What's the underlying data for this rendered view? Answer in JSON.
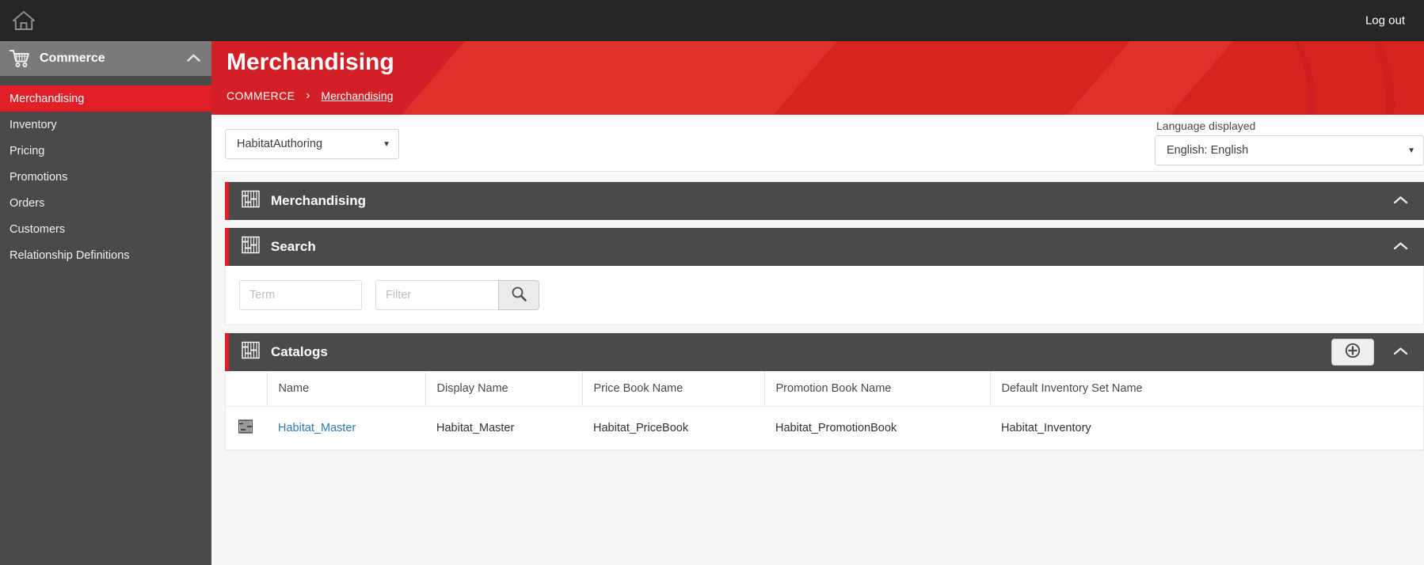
{
  "topbar": {
    "home_icon": "home-icon",
    "logout_label": "Log out"
  },
  "sidebar": {
    "group": {
      "icon": "shopping-cart-icon",
      "label": "Commerce",
      "collapse_icon": "chevron-up-icon"
    },
    "items": [
      {
        "label": "Merchandising",
        "active": true
      },
      {
        "label": "Inventory",
        "active": false
      },
      {
        "label": "Pricing",
        "active": false
      },
      {
        "label": "Promotions",
        "active": false
      },
      {
        "label": "Orders",
        "active": false
      },
      {
        "label": "Customers",
        "active": false
      },
      {
        "label": "Relationship Definitions",
        "active": false
      }
    ]
  },
  "header": {
    "title": "Merchandising",
    "breadcrumb": {
      "root": "COMMERCE",
      "separator": "›",
      "current": "Merchandising"
    },
    "accent_color": "#d32027"
  },
  "toolbar": {
    "catalog_select": {
      "value": "HabitatAuthoring",
      "caret_icon": "caret-down-icon"
    },
    "language": {
      "label": "Language displayed",
      "value": "English: English",
      "caret_icon": "caret-down-icon"
    }
  },
  "panels": {
    "merchandising": {
      "icon": "grid-table-icon",
      "title": "Merchandising",
      "collapse_icon": "chevron-up-icon"
    },
    "search": {
      "icon": "grid-table-icon",
      "title": "Search",
      "collapse_icon": "chevron-up-icon",
      "term_placeholder": "Term",
      "term_value": "",
      "filter_placeholder": "Filter",
      "filter_value": "",
      "search_icon": "magnifier-icon"
    },
    "catalogs": {
      "icon": "grid-table-icon",
      "title": "Catalogs",
      "add_icon": "plus-circle-icon",
      "collapse_icon": "chevron-up-icon",
      "columns": [
        "Name",
        "Display Name",
        "Price Book Name",
        "Promotion Book Name",
        "Default Inventory Set Name"
      ],
      "rows": [
        {
          "row_icon": "catalog-icon",
          "name": "Habitat_Master",
          "display_name": "Habitat_Master",
          "price_book_name": "Habitat_PriceBook",
          "promotion_book_name": "Habitat_PromotionBook",
          "default_inventory_set_name": "Habitat_Inventory"
        }
      ]
    }
  }
}
